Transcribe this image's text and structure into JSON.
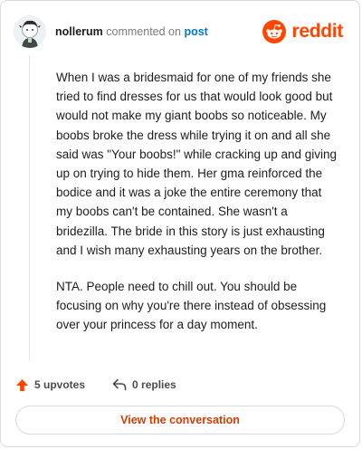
{
  "header": {
    "username": "nollerum",
    "action_text": "commented on",
    "post_link": "post",
    "brand": "reddit"
  },
  "comment": {
    "paragraphs": [
      "When I was a bridesmaid for one of my friends she tried to find dresses for us that would look good but would not make my giant boobs so noticeable. My boobs broke the dress while trying it on and all she said was \"Your boobs!\" while cracking up and giving up on trying to hide them. Her gma reinforced the bodice and it was a joke the entire ceremony that my boobs can't be contained. She wasn't a bridezilla. The bride in this story is just exhausting and I wish many exhausting years on the brother.",
      "NTA. People need to chill out. You should be focusing on why you're there instead of obsessing over your princess for a day moment."
    ]
  },
  "footer": {
    "upvotes": "5 upvotes",
    "replies": "0 replies",
    "upvote_icon": "upvote-arrow-icon",
    "reply_icon": "reply-arrow-icon"
  },
  "cta": {
    "label": "View the conversation"
  },
  "colors": {
    "brand": "#ff4500",
    "link": "#0079d3",
    "cta_text": "#d93a00",
    "border": "#d7dadc"
  }
}
